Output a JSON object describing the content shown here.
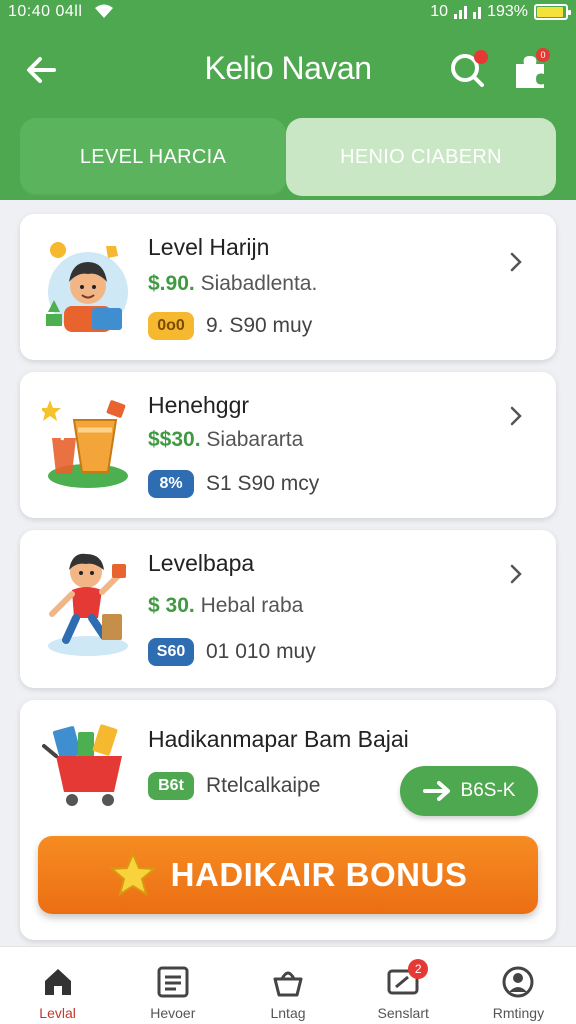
{
  "status_bar": {
    "time": "10:40 04ll",
    "alarm": "10",
    "battery": "193%"
  },
  "header": {
    "title": "Kelio Navan"
  },
  "tabs": [
    {
      "label": "LEVEL HARCIA",
      "active": true
    },
    {
      "label": "HENIO CIABERN",
      "active": false
    }
  ],
  "cards": [
    {
      "title": "Level Harijn",
      "price": "$.90.",
      "price_note": "Siabadlenta.",
      "badge": "0o0",
      "badge_color": "#f6b82f",
      "meta": "9. S90 muy",
      "illustration": "kid-with-gifts"
    },
    {
      "title": "Henehggr",
      "price": "$$30.",
      "price_note": "Siabararta",
      "badge": "8%",
      "badge_color": "#2f6db3",
      "meta": "S1 S90 mcy",
      "illustration": "juice-cup"
    },
    {
      "title": "Levelbapa",
      "price": "$ 30.",
      "price_note": "Hebal raba",
      "badge": "S60",
      "badge_color": "#2f6db3",
      "meta": "01 010 muy",
      "illustration": "running-kid"
    },
    {
      "title": "Hadikanmapar Bam Bajai",
      "badge": "B6t",
      "badge_color": "#4ea84f",
      "meta": "Rtelcalkaipe",
      "illustration": "shopping-cart",
      "button": "B6S-K"
    }
  ],
  "bonus_button": {
    "label": "HADIKAIR BONUS",
    "icon": "star-icon"
  },
  "bottom_nav": [
    {
      "label": "Levlal",
      "icon": "home-icon",
      "active": true
    },
    {
      "label": "Hevoer",
      "icon": "list-icon",
      "active": false
    },
    {
      "label": "Lntag",
      "icon": "basket-icon",
      "active": false
    },
    {
      "label": "Senslart",
      "icon": "ticket-icon",
      "active": false,
      "badge": "2"
    },
    {
      "label": "Rmtingy",
      "icon": "profile-icon",
      "active": false
    }
  ],
  "colors": {
    "header": "#4ea84f",
    "price": "#3f9a41",
    "bonus": "#f07b18",
    "active_nav": "#c0392b"
  }
}
